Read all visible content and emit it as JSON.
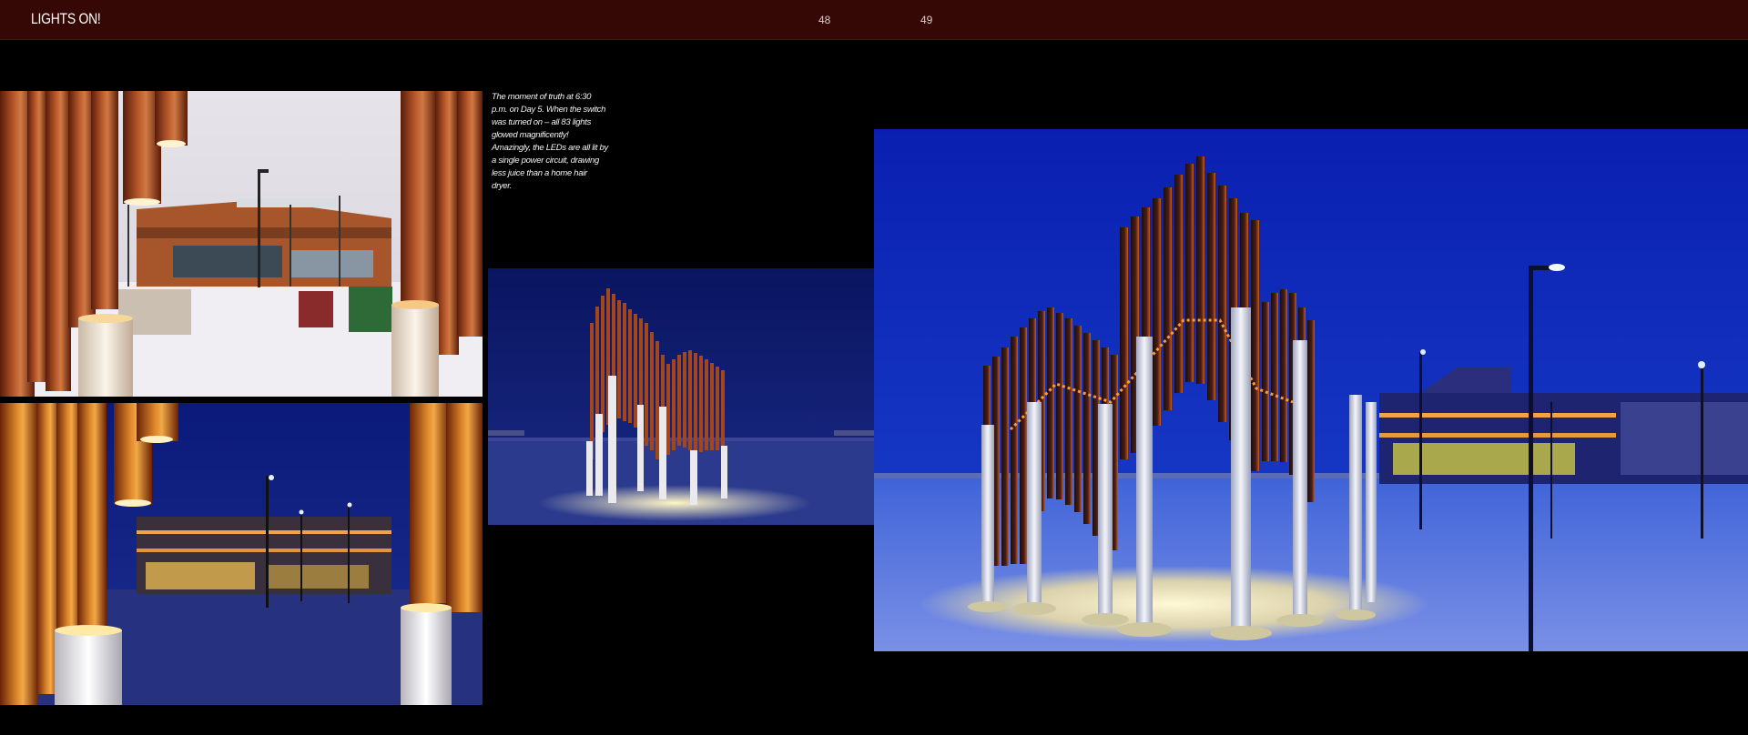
{
  "header": {
    "section_title": "LIGHTS ON!",
    "page_left": "48",
    "page_right": "49"
  },
  "caption": {
    "text": "The moment of truth at 6:30 p.m. on Day 5. When the switch was turned on – all 83 lights glowed magnificently! Amazingly, the LEDs are all lit by a single power circuit, drawing less juice than a home hair dryer."
  },
  "colors": {
    "header_bg": "#350805",
    "page_bg": "#000000",
    "copper": "#b5541f",
    "night_blue": "#0a1f9c",
    "snow_day": "#ece9ee"
  }
}
